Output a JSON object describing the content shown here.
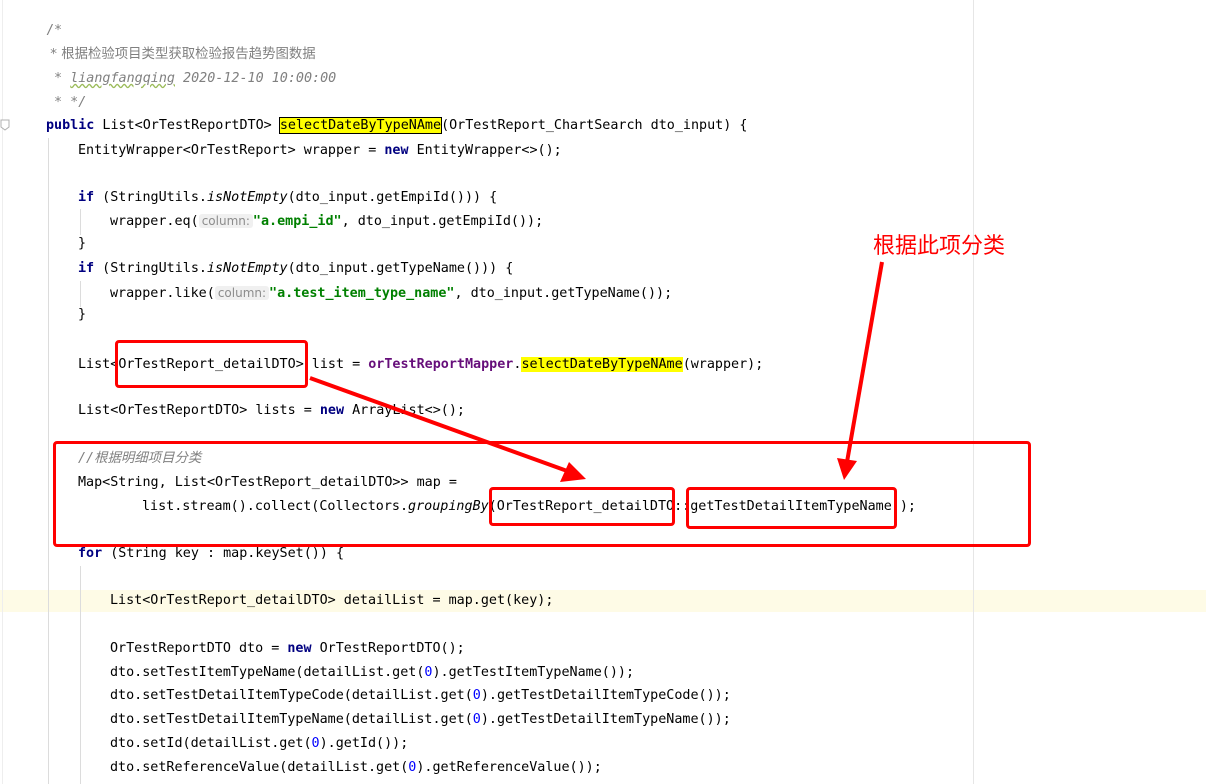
{
  "annotation": {
    "label": "根据此项分类",
    "color": "#ff0000"
  },
  "colors": {
    "keyword": "#000080",
    "comment": "#808080",
    "string": "#008000",
    "number": "#0000ff",
    "field": "#660e7a",
    "highlight": "#ffff00",
    "current_line": "#fefbe6"
  },
  "code": {
    "doc_open": "/*",
    "doc_desc": " * 根据检验项目类型获取检验报告趋势图数据",
    "doc_author": "liangfangqing",
    "doc_date": " 2020-12-10 10:00:00",
    "doc_close": " * */",
    "kw_public": "public",
    "method_sig_a": " List<OrTestReportDTO> ",
    "method_name": "selectDateByTypeNAme",
    "method_sig_b": "(OrTestReport_ChartSearch dto_input) {",
    "wrapper_decl_a": "EntityWrapper<OrTestReport> wrapper = ",
    "kw_new": "new",
    "wrapper_decl_b": " EntityWrapper<>();",
    "kw_if": "if",
    "if1_a": " (StringUtils.",
    "is_not_empty": "isNotEmpty",
    "if1_b": "(dto_input.getEmpiId())) {",
    "eq_call": "wrapper.eq(",
    "hint_column": "column:",
    "str_empi": "\"a.empi_id\"",
    "eq_rest": ", dto_input.getEmpiId());",
    "close_brace": "}",
    "if2_b": "(dto_input.getTypeName())) {",
    "like_call": "wrapper.like(",
    "str_type": "\"a.test_item_type_name\"",
    "like_rest": ", dto_input.getTypeName());",
    "list_a": "List<",
    "list_type": "OrTestReport_detailDTO",
    "list_b": "> list = ",
    "mapper_field": "orTestReportMapper",
    "dot": ".",
    "mapper_call_rest": "(wrapper);",
    "lists_a": "List<OrTestReportDTO> lists = ",
    "lists_b": " ArrayList<>();",
    "comment_group": "//根据明细项目分类",
    "map_decl": "Map<String, List<OrTestReport_detailDTO>> map =",
    "stream_a": "list.stream().collect(Collectors.",
    "grouping_by": "groupingBy",
    "stream_b": "(",
    "dto_class": "OrTestReport_detailDTO",
    "method_ref": "::",
    "getter_name": "getTestDetailItemTypeName",
    "stream_c": "));",
    "kw_for": "for",
    "for_rest": " (String key : map.keySet()) {",
    "detail_list": "List<OrTestReport_detailDTO> detailList = map.get(key);",
    "dto_new_a": "OrTestReportDTO dto = ",
    "dto_new_b": " OrTestReportDTO();",
    "set1_a": "dto.setTestItemTypeName(detailList.get(",
    "zero": "0",
    "set1_b": ").getTestItemTypeName());",
    "set2_a": "dto.setTestDetailItemTypeCode(detailList.get(",
    "set2_b": ").getTestDetailItemTypeCode());",
    "set3_a": "dto.setTestDetailItemTypeName(detailList.get(",
    "set3_b": ").getTestDetailItemTypeName());",
    "set4_a": "dto.setId(detailList.get(",
    "set4_b": ").getId());",
    "set5_a": "dto.setReferenceValue(detailList.get(",
    "set5_b": ").getReferenceValue());"
  }
}
